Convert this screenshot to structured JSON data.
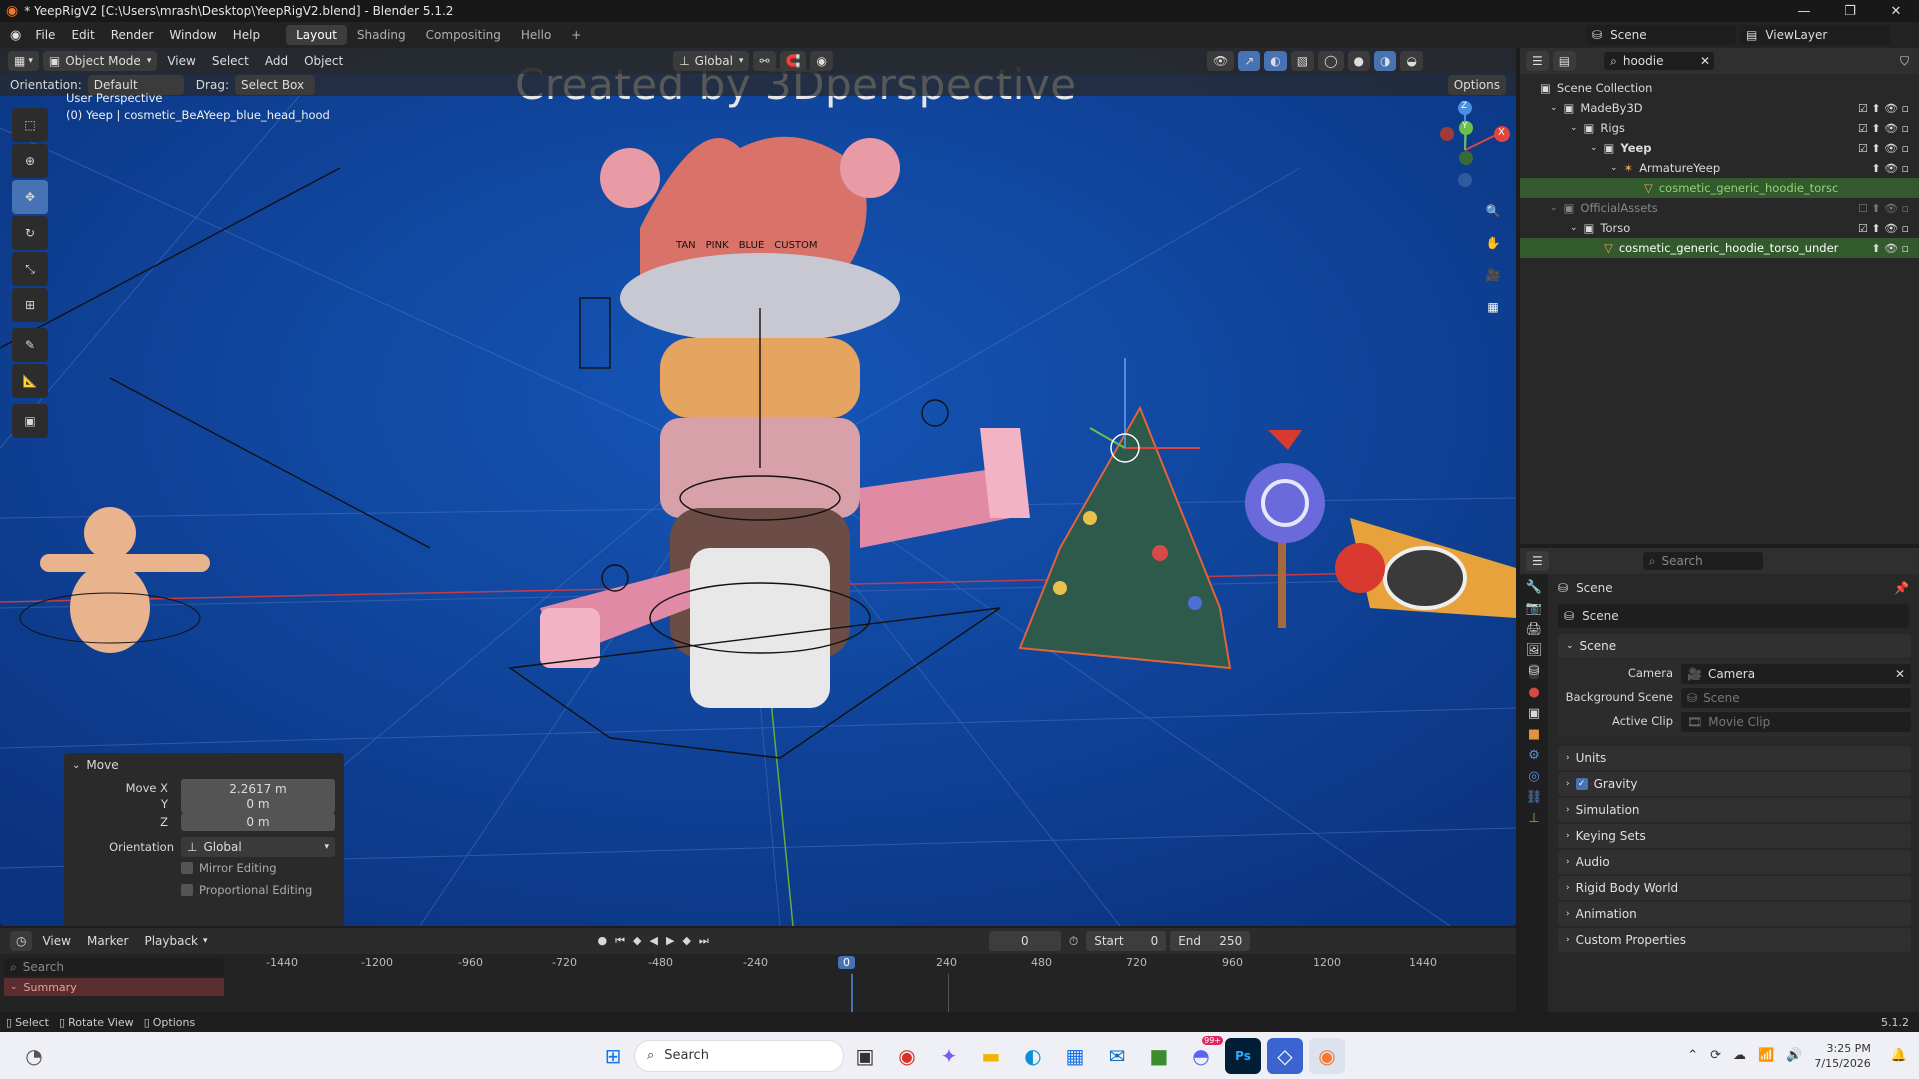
{
  "window": {
    "title": "* YeepRigV2 [C:\\Users\\mrash\\Desktop\\YeepRigV2.blend] - Blender 5.1.2",
    "controls": [
      "—",
      "❐",
      "✕"
    ]
  },
  "menu": {
    "items": [
      "File",
      "Edit",
      "Render",
      "Window",
      "Help"
    ],
    "workspaces": [
      "Layout",
      "Shading",
      "Compositing",
      "Hello"
    ],
    "active_workspace": "Layout",
    "add": "+",
    "scene_label": "Scene",
    "viewlayer_label": "ViewLayer"
  },
  "viewport": {
    "mode": "Object Mode",
    "menus": [
      "View",
      "Select",
      "Add",
      "Object"
    ],
    "transform_orientation": "Global",
    "orientation_label": "Orientation:",
    "orientation_value": "Default",
    "drag_label": "Drag:",
    "drag_value": "Select Box",
    "options": "Options",
    "perspective": "User Perspective",
    "active_object": "(0) Yeep | cosmetic_BeAYeep_blue_head_hood",
    "overlay_text": "Created by 3Dperspective",
    "head_labels": [
      "TAN",
      "PINK",
      "BLUE",
      "CUSTOM"
    ],
    "gizmo_axes": {
      "z": "Z",
      "y": "Y",
      "x": "X"
    }
  },
  "operator_panel": {
    "title": "Move",
    "move_x_label": "Move X",
    "move_x": "2.2617 m",
    "y_label": "Y",
    "y": "0 m",
    "z_label": "Z",
    "z": "0 m",
    "orientation_label": "Orientation",
    "orientation": "Global",
    "mirror": "Mirror Editing",
    "proportional": "Proportional Editing"
  },
  "outliner": {
    "search": "hoodie",
    "rows": [
      {
        "label": "Scene Collection",
        "indent": 0
      },
      {
        "label": "MadeBy3D",
        "indent": 1
      },
      {
        "label": "Rigs",
        "indent": 2
      },
      {
        "label": "Yeep",
        "indent": 3
      },
      {
        "label": "ArmatureYeep",
        "indent": 4
      },
      {
        "label": "cosmetic_generic_hoodie_torsc",
        "indent": 5
      },
      {
        "label": "OfficialAssets",
        "indent": 1
      },
      {
        "label": "Torso",
        "indent": 2
      },
      {
        "label": "cosmetic_generic_hoodie_torso_under",
        "indent": 3
      }
    ]
  },
  "properties": {
    "search_placeholder": "Search",
    "context": "Scene",
    "datablock": "Scene",
    "section": "Scene",
    "camera_label": "Camera",
    "camera": "Camera",
    "bg_label": "Background Scene",
    "bg_placeholder": "Scene",
    "clip_label": "Active Clip",
    "clip_placeholder": "Movie Clip",
    "panels": [
      "Units",
      "Gravity",
      "Simulation",
      "Keying Sets",
      "Audio",
      "Rigid Body World",
      "Animation",
      "Custom Properties"
    ]
  },
  "timeline": {
    "menus": [
      "View",
      "Marker",
      "Playback"
    ],
    "current_frame": "0",
    "start_label": "Start",
    "start": "0",
    "end_label": "End",
    "end": "250",
    "search_placeholder": "Search",
    "summary": "Summary",
    "ticks": [
      "-1440",
      "-1200",
      "-960",
      "-720",
      "-480",
      "-240",
      "0",
      "240",
      "480",
      "720",
      "960",
      "1200",
      "1440"
    ]
  },
  "status": {
    "items": [
      "Select",
      "Rotate View",
      "Options"
    ],
    "version": "5.1.2"
  },
  "taskbar": {
    "search": "Search",
    "time": "3:25 PM",
    "date": "7/15/2026",
    "badge": "99+"
  }
}
